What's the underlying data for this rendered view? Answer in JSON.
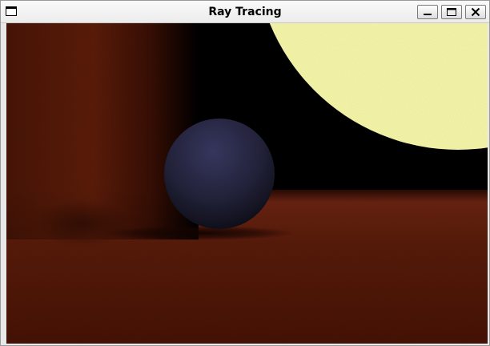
{
  "window": {
    "title": "Ray Tracing",
    "controls": {
      "minimize": "minimize",
      "maximize": "maximize",
      "close": "close"
    }
  },
  "scene": {
    "colors": {
      "floor_near": "#521607",
      "floor_horizon": "#6b2412",
      "wall_left": "#5a1a08",
      "shadow": "#1a0603",
      "sky": "#000000",
      "light_sphere": "#ffffb0",
      "sphere": "#2a2a50"
    }
  }
}
